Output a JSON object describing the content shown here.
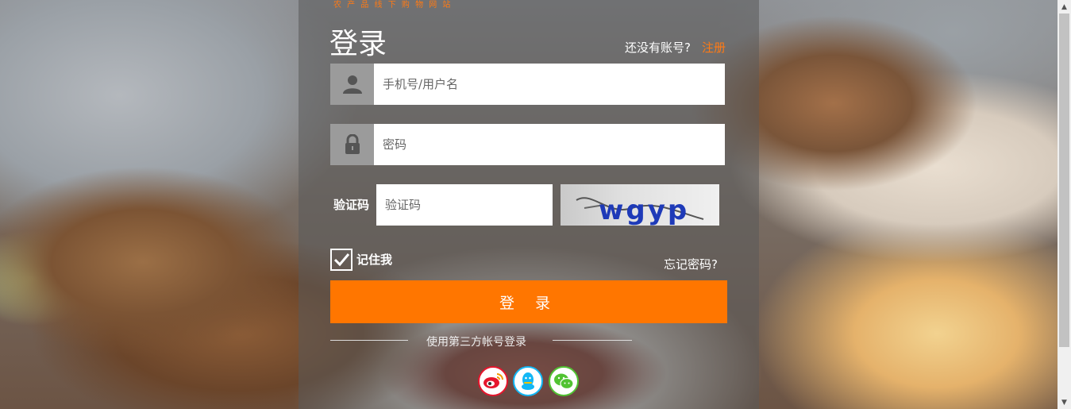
{
  "brand": {
    "tagline": "农 产 品 线 下 购 物 网 站"
  },
  "login": {
    "title": "登录",
    "register_prompt": "还没有账号?",
    "register_link": "注册",
    "username_placeholder": "手机号/用户名",
    "password_placeholder": "密码",
    "captcha_label": "验证码",
    "captcha_placeholder": "验证码",
    "captcha_text": "wgyp",
    "remember_label": "记住我",
    "remember_checked": true,
    "forgot_link": "忘记密码?",
    "submit_label": "登 录",
    "third_party_text": "使用第三方帐号登录",
    "social": [
      "weibo-icon",
      "qq-icon",
      "wechat-icon"
    ]
  },
  "colors": {
    "accent": "#ff7600",
    "weibo": "#e6162d",
    "qq": "#12b7f5",
    "wechat": "#51c332"
  }
}
